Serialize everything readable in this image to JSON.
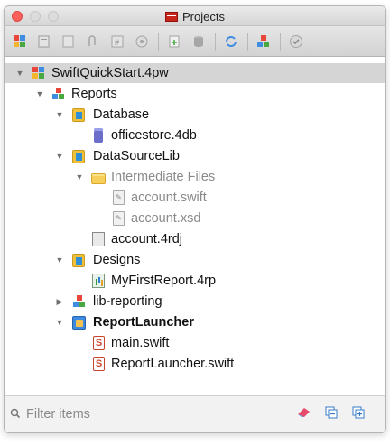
{
  "window": {
    "title": "Projects"
  },
  "toolbar": {
    "buttons": [
      "new-project-icon",
      "open-icon",
      "close-project-icon",
      "attach-icon",
      "compile-icon",
      "settings-icon",
      "add-file-icon",
      "database-icon",
      "sync-icon",
      "components-icon",
      "check-icon"
    ]
  },
  "tree": {
    "items": [
      {
        "label": "SwiftQuickStart.4pw",
        "icon": "project-icon",
        "expanded": true,
        "selected": true
      },
      {
        "label": "Reports",
        "icon": "components-icon",
        "expanded": true
      },
      {
        "label": "Database",
        "icon": "group-folder-icon",
        "expanded": true
      },
      {
        "label": "officestore.4db",
        "icon": "database-file-icon"
      },
      {
        "label": "DataSourceLib",
        "icon": "group-folder-icon",
        "expanded": true
      },
      {
        "label": "Intermediate Files",
        "icon": "folder-icon",
        "expanded": true,
        "dimmed": true
      },
      {
        "label": "account.swift",
        "icon": "generated-file-icon",
        "dimmed": true
      },
      {
        "label": "account.xsd",
        "icon": "generated-file-icon",
        "dimmed": true
      },
      {
        "label": "account.4rdj",
        "icon": "report-data-icon"
      },
      {
        "label": "Designs",
        "icon": "group-folder-icon",
        "expanded": true
      },
      {
        "label": "MyFirstReport.4rp",
        "icon": "report-design-icon"
      },
      {
        "label": "lib-reporting",
        "icon": "components-icon",
        "expanded": false
      },
      {
        "label": "ReportLauncher",
        "icon": "launcher-icon",
        "expanded": true,
        "bold": true
      },
      {
        "label": "main.swift",
        "icon": "swift-file-icon"
      },
      {
        "label": "ReportLauncher.swift",
        "icon": "swift-file-icon"
      }
    ]
  },
  "filter": {
    "placeholder": "Filter items",
    "value": ""
  },
  "colors": {
    "selection": "#d5d5d5",
    "dimmed_text": "#8a8a8a",
    "close_button": "#fc605c"
  }
}
